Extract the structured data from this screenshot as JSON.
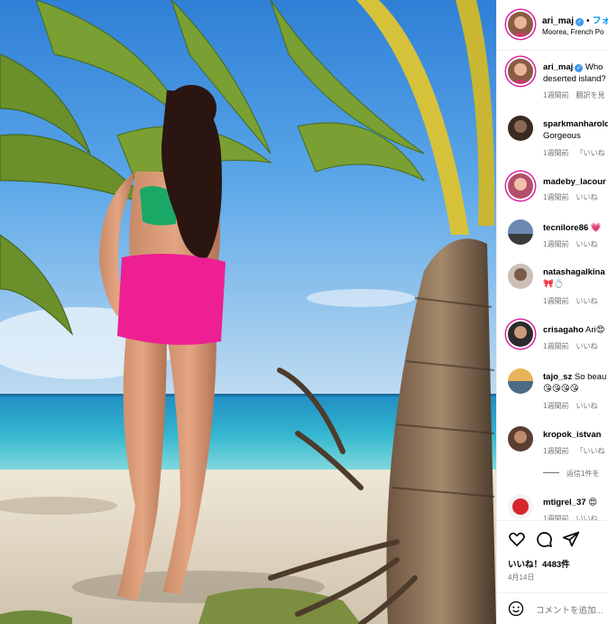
{
  "post": {
    "username": "ari_maj",
    "follow_label": "フォ",
    "location": "Moorea, French Po",
    "caption_line1": "Who",
    "caption_line2": "deserted island?",
    "caption_time": "1週間前",
    "caption_translate": "翻訳を見"
  },
  "comments": [
    {
      "user": "sparkmanharold",
      "text": "",
      "line2": "Gorgeous",
      "time": "1週間前",
      "action": "「いいね"
    },
    {
      "user": "madeby_lacour",
      "text": "",
      "line2": "",
      "time": "1週間前",
      "action": "いいね"
    },
    {
      "user": "tecnilore86",
      "text": "💗",
      "line2": "",
      "time": "1週間前",
      "action": "いいね"
    },
    {
      "user": "natashagalkina",
      "text": "",
      "line2": "🎀💍",
      "time": "1週間前",
      "action": "いいね"
    },
    {
      "user": "crisagaho",
      "text": "Ari😍",
      "line2": "",
      "time": "1週間前",
      "action": "いいね"
    },
    {
      "user": "tajo_sz",
      "text": "So beau",
      "line2": "😘😘😘😘",
      "time": "1週間前",
      "action": "いいね"
    },
    {
      "user": "kropok_istvan",
      "text": "",
      "line2": "",
      "time": "1週間前",
      "action": "「いいね"
    },
    {
      "user": "mtigrel_37",
      "text": "😍",
      "line2": "",
      "time": "1週間前",
      "action": "いいね"
    }
  ],
  "view_replies": "返信1件を",
  "likes_text": "いいね！4483件",
  "post_date": "4月14日",
  "comment_placeholder": "コメントを追加...",
  "icons": [
    "heart-icon",
    "comment-icon",
    "share-icon",
    "emoji-icon",
    "verified-badge-icon"
  ],
  "colors": {
    "accent": "#0095f6",
    "verified": "#3897f0",
    "story_ring": "#d6249f",
    "muted": "#737373"
  }
}
